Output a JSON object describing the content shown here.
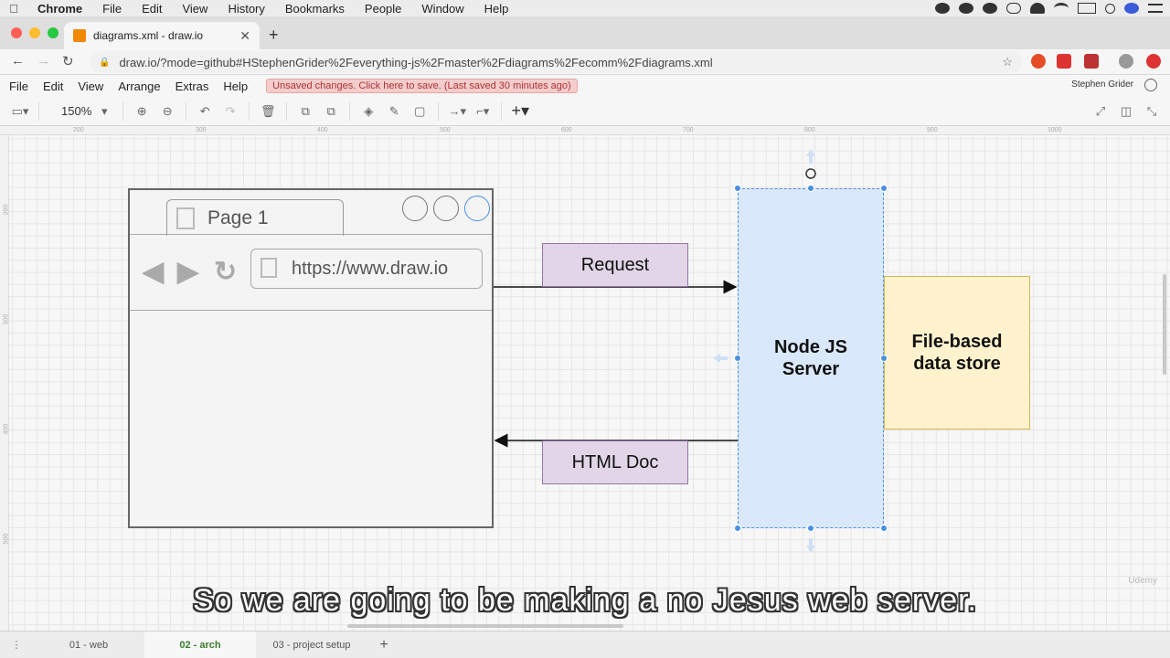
{
  "mac_menubar": {
    "items": [
      "Chrome",
      "File",
      "Edit",
      "View",
      "History",
      "Bookmarks",
      "People",
      "Window",
      "Help"
    ]
  },
  "chrome": {
    "tab_title": "diagrams.xml - draw.io",
    "url": "draw.io/?mode=github#HStephenGrider%2Feverything-js%2Fmaster%2Fdiagrams%2Fecomm%2Fdiagrams.xml"
  },
  "drawio": {
    "menu": [
      "File",
      "Edit",
      "View",
      "Arrange",
      "Extras",
      "Help"
    ],
    "unsaved_notice": "Unsaved changes. Click here to save. (Last saved 30 minutes ago)",
    "user_name": "Stephen Grider",
    "zoom": "150%"
  },
  "rulers": {
    "top": [
      "200",
      "300",
      "400",
      "500",
      "600",
      "700",
      "800",
      "900",
      "1000"
    ],
    "left": [
      "200",
      "300",
      "400",
      "500"
    ]
  },
  "diagram": {
    "mock_tab_label": "Page 1",
    "mock_url": "https://www.draw.io",
    "request_label": "Request",
    "html_doc_label": "HTML Doc",
    "server_label_line1": "Node JS",
    "server_label_line2": "Server",
    "store_label_line1": "File-based",
    "store_label_line2": "data store"
  },
  "subtitle": "So we are going to be making a no Jesus web server.",
  "pages": [
    "01 - web",
    "02 - arch",
    "03 - project setup"
  ],
  "active_page": "02 - arch",
  "watermark": "Udemy",
  "colors": {
    "request_fill": "#e1d5e7",
    "server_fill": "#dae8fc",
    "store_fill": "#fff2cc",
    "selection": "#4a90e2",
    "active_page": "#3a7d2e"
  }
}
